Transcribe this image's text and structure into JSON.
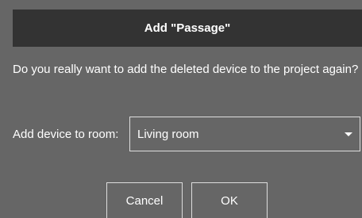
{
  "dialog": {
    "title": "Add \"Passage\"",
    "message": "Do you really want to add the deleted device to the project again?",
    "room_label": "Add device to room:",
    "room_select": {
      "value": "Living room",
      "caret_icon": "caret-down-icon"
    },
    "buttons": {
      "cancel": "Cancel",
      "ok": "OK"
    }
  },
  "colors": {
    "dialog_background": "#666666",
    "title_bar": "#333333",
    "text": "#ffffff",
    "border": "#dddddd"
  }
}
